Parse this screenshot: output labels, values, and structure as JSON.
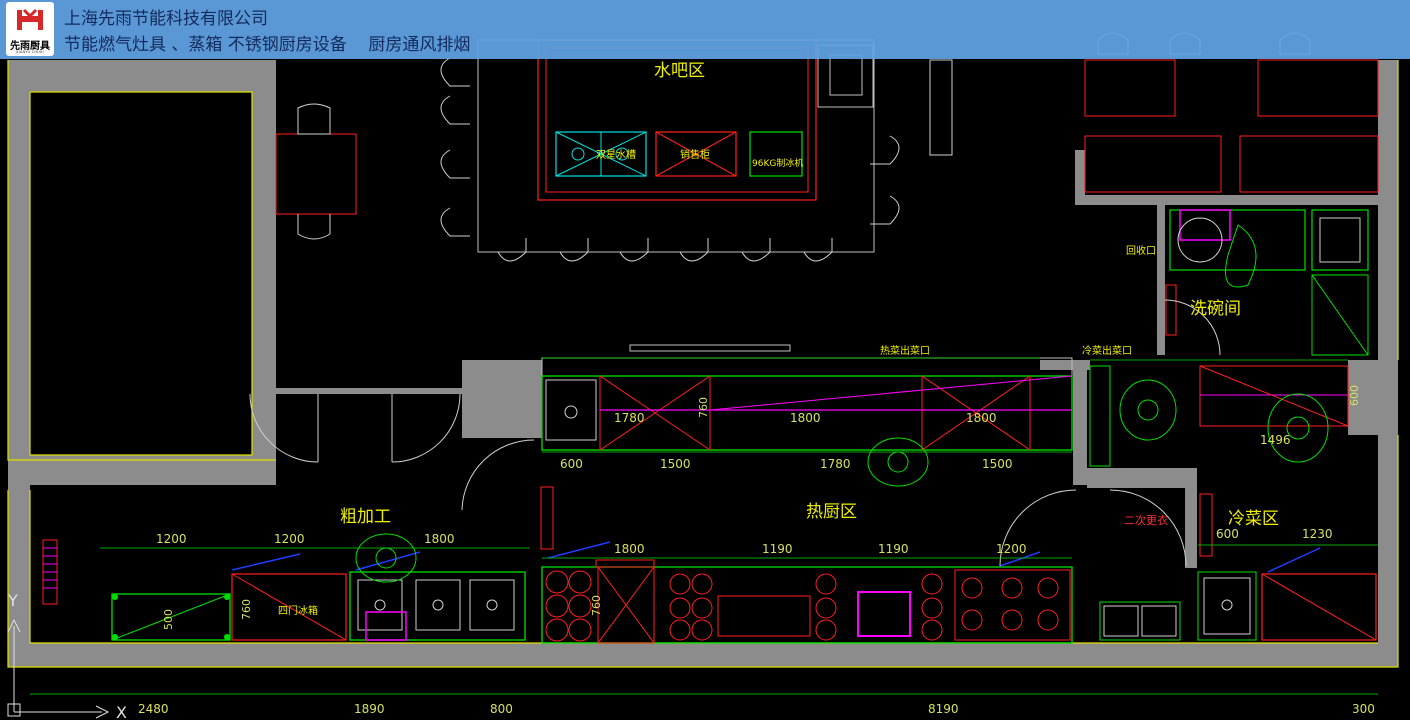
{
  "header": {
    "company_name": "上海先雨节能科技有限公司",
    "products": "节能燃气灶具 、蒸箱 不锈钢厨房设备    厨房通风排烟",
    "logo_text": "先雨厨具",
    "logo_subtext": "XIANYU CHUJU"
  },
  "colors": {
    "header_bg": "#60a4e4",
    "wall_fill": "#8c8c8c",
    "wall_line": "#e0e000",
    "equip_green": "#00e000",
    "equip_red": "#ff2020",
    "equip_magenta": "#ff00ff",
    "equip_cyan": "#00e0e0",
    "dim_text": "#d8e060",
    "zone_label": "#f0f000",
    "blue_hood": "#1e3cff"
  },
  "zones": {
    "water_bar": "水吧区",
    "hot_kitchen": "热厨区",
    "rough_process": "粗加工",
    "cold_dish": "冷菜区",
    "dishwash": "洗碗间"
  },
  "labels": {
    "hot_dish_window": "热菜出菜口",
    "cold_dish_window": "冷菜出菜口",
    "recycle_window": "回收口",
    "second_changing": "二次更衣",
    "double_sink": "双星水槽",
    "display_cabinet": "销售柜",
    "ice_machine": "96KG制冰机",
    "freezer": "四门冰箱"
  },
  "dimensions": {
    "top_row": [
      "1780",
      "760",
      "1800",
      "1800",
      "1496",
      "600"
    ],
    "second_row": [
      "600",
      "1500",
      "1780",
      "1500"
    ],
    "left_row": [
      "1200",
      "1200",
      "1800"
    ],
    "bottom_row": [
      "1800",
      "1190",
      "1190",
      "1200",
      "600",
      "1230"
    ],
    "vertical": [
      "500",
      "760",
      "760"
    ],
    "bottom_axis": [
      "2480",
      "1890",
      "800",
      "8190",
      "300"
    ]
  },
  "axis": {
    "y_label": "Y",
    "x_label": "X"
  }
}
